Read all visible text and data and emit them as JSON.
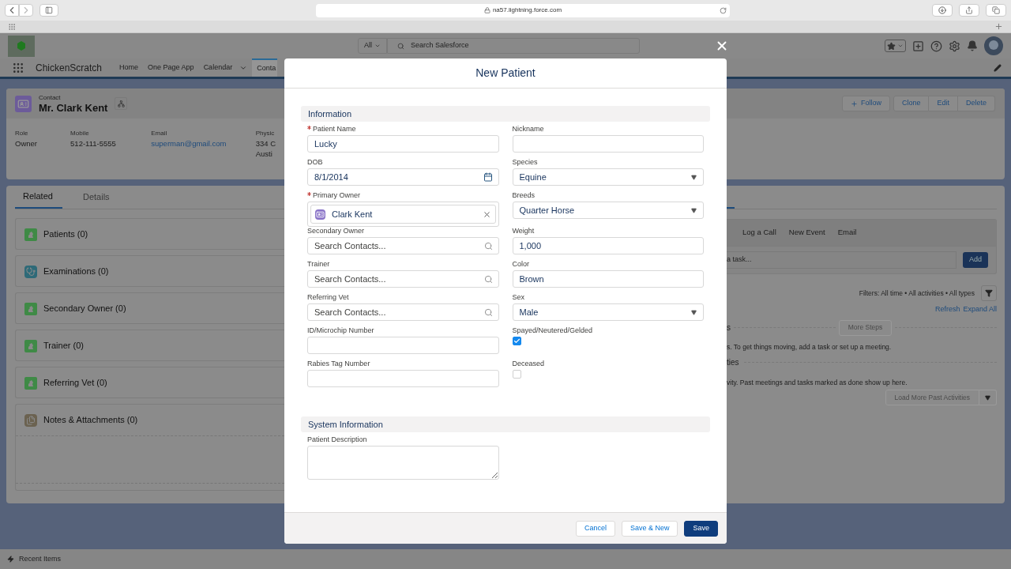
{
  "browser": {
    "url": "na57.lightning.force.com"
  },
  "header": {
    "search_scope": "All",
    "search_placeholder": "Search Salesforce"
  },
  "nav": {
    "app_name": "ChickenScratch",
    "items": [
      {
        "label": "Home",
        "selected": false,
        "has_menu": false
      },
      {
        "label": "One Page App",
        "selected": false,
        "has_menu": false
      },
      {
        "label": "Calendar",
        "selected": false,
        "has_menu": true
      },
      {
        "label": "Conta",
        "selected": true,
        "has_menu": false
      }
    ]
  },
  "record": {
    "type": "Contact",
    "name": "Mr. Clark Kent",
    "actions": [
      {
        "label": "Follow",
        "kind": "follow"
      },
      {
        "label": "Clone",
        "kind": "plain"
      },
      {
        "label": "Edit",
        "kind": "plain"
      },
      {
        "label": "Delete",
        "kind": "plain"
      }
    ],
    "fields": [
      {
        "label": "Role",
        "kind": "text",
        "lines": [
          "Owner"
        ]
      },
      {
        "label": "Mobile",
        "kind": "text",
        "lines": [
          "512-111-5555"
        ]
      },
      {
        "label": "Email",
        "kind": "link",
        "lines": [
          "superman@gmail.com"
        ]
      },
      {
        "label": "Physic",
        "kind": "text",
        "lines": [
          "334 C",
          "Austi"
        ]
      }
    ]
  },
  "related": {
    "tabs": [
      {
        "label": "Related",
        "selected": true
      },
      {
        "label": "Details",
        "selected": false
      }
    ],
    "lists": [
      {
        "title": "Patients (0)",
        "kind": "horse"
      },
      {
        "title": "Examinations (0)",
        "kind": "exam"
      },
      {
        "title": "Secondary Owner (0)",
        "kind": "horse"
      },
      {
        "title": "Trainer (0)",
        "kind": "horse"
      },
      {
        "title": "Referring Vet (0)",
        "kind": "horse"
      },
      {
        "title": "Notes & Attachments (0)",
        "kind": "notes"
      }
    ]
  },
  "activity": {
    "tabs": [
      "Log a Call",
      "New Event",
      "Email"
    ],
    "task_placeholder": "a task...",
    "add_label": "Add",
    "filters": "Filters: All time • All activities • All types",
    "links": [
      "Refresh",
      "Expand All"
    ],
    "next_heading": "s",
    "more_steps": "More Steps",
    "next_text": "s. To get things moving, add a task or set up a meeting.",
    "past_heading": "ties",
    "past_text": "vity. Past meetings and tasks marked as done show up here.",
    "load_more": "Load More Past Activities"
  },
  "utility_bar": {
    "label": "Recent Items"
  },
  "modal": {
    "title": "New Patient",
    "sections": [
      {
        "title": "Information",
        "fields": [
          {
            "label": "Patient Name",
            "kind": "text",
            "required": true,
            "value": "Lucky"
          },
          {
            "label": "Nickname",
            "kind": "text",
            "required": false
          },
          {
            "label": "DOB",
            "kind": "date",
            "required": false,
            "value": "8/1/2014"
          },
          {
            "label": "Species",
            "kind": "picklist",
            "required": false,
            "value": "Equine"
          },
          {
            "label": "Primary Owner",
            "kind": "lookup_selected",
            "required": true,
            "value": "Clark Kent"
          },
          {
            "label": "Breeds",
            "kind": "picklist",
            "required": false,
            "value": "Quarter Horse"
          },
          {
            "label": "Secondary Owner",
            "kind": "lookup",
            "required": false,
            "placeholder": "Search Contacts..."
          },
          {
            "label": "Weight",
            "kind": "text",
            "required": false,
            "value": "1,000"
          },
          {
            "label": "Trainer",
            "kind": "lookup",
            "required": false,
            "placeholder": "Search Contacts..."
          },
          {
            "label": "Color",
            "kind": "text",
            "required": false,
            "value": "Brown"
          },
          {
            "label": "Referring Vet",
            "kind": "lookup",
            "required": false,
            "placeholder": "Search Contacts..."
          },
          {
            "label": "Sex",
            "kind": "picklist",
            "required": false,
            "value": "Male"
          },
          {
            "label": "ID/Microchip Number",
            "kind": "text",
            "required": false
          },
          {
            "label": "Spayed/Neutered/Gelded",
            "kind": "checkbox",
            "required": false,
            "checked": true
          },
          {
            "label": "Rabies Tag Number",
            "kind": "text",
            "required": false
          },
          {
            "label": "Deceased",
            "kind": "checkbox",
            "required": false,
            "checked": false
          }
        ]
      },
      {
        "title": "System Information",
        "fields": [
          {
            "label": "Patient Description",
            "kind": "textarea",
            "required": false
          }
        ]
      }
    ],
    "buttons": [
      {
        "label": "Cancel",
        "kind": "neutral"
      },
      {
        "label": "Save & New",
        "kind": "neutral"
      },
      {
        "label": "Save",
        "kind": "brand"
      }
    ]
  }
}
